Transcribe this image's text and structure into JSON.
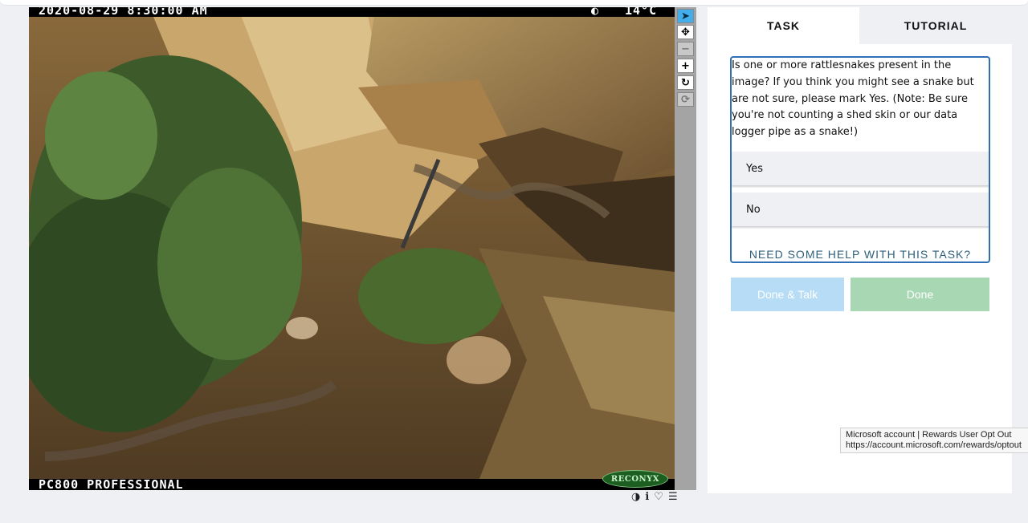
{
  "viewer": {
    "timestamp": "2020-08-29 8:30:00 AM",
    "moon_glyph": "◐",
    "temperature": "14°C",
    "camera_model": "PC800 PROFESSIONAL",
    "brand_logo": "RECONYX",
    "toolbar": [
      {
        "name": "pointer-icon",
        "glyph": "➤",
        "state": "active"
      },
      {
        "name": "move-icon",
        "glyph": "✥",
        "state": "normal"
      },
      {
        "name": "zoom-out-icon",
        "glyph": "−",
        "state": "disabled"
      },
      {
        "name": "zoom-in-icon",
        "glyph": "+",
        "state": "normal"
      },
      {
        "name": "rotate-icon",
        "glyph": "↻",
        "state": "normal"
      },
      {
        "name": "reset-icon",
        "glyph": "⟳",
        "state": "disabled"
      }
    ],
    "meta_icons": {
      "invert": "◑",
      "info": "ℹ",
      "favorite": "♡",
      "collections": "☰"
    }
  },
  "panel": {
    "tabs": {
      "task": "TASK",
      "tutorial": "TUTORIAL"
    },
    "question": "Is one or more rattlesnakes present in the image? If you think you might see a snake but are not sure, please mark Yes. (Note: Be sure you're not counting a shed skin or our data logger pipe as a snake!)",
    "answers": {
      "yes": "Yes",
      "no": "No"
    },
    "help_link": "NEED SOME HELP WITH THIS TASK?",
    "buttons": {
      "done_talk": "Done & Talk",
      "done": "Done"
    }
  },
  "tooltip": {
    "title": "Microsoft account | Rewards User Opt Out",
    "url": "https://account.microsoft.com/rewards/optout"
  },
  "colors": {
    "accent": "#2f6fb5",
    "talk_button": "#b6dcf6",
    "done_button": "#a8d8b3",
    "page_bg": "#eef0f3",
    "active_tool": "#43aee9"
  }
}
